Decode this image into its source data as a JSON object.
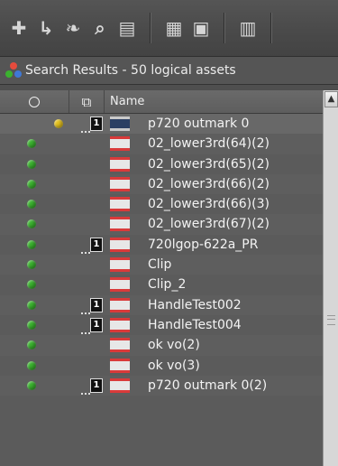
{
  "toolbar": {
    "buttons": [
      {
        "name": "add-icon",
        "glyph": "+"
      },
      {
        "name": "move-icon",
        "glyph": "↳"
      },
      {
        "name": "tree-icon",
        "glyph": "♣"
      },
      {
        "name": "find-icon",
        "glyph": "⌕"
      },
      {
        "name": "list-icon",
        "glyph": "▤"
      },
      {
        "name": "export-icon",
        "glyph": "▦"
      },
      {
        "name": "folder-icon",
        "glyph": "▣"
      },
      {
        "name": "columns-icon",
        "glyph": "▥"
      }
    ]
  },
  "results": {
    "label": "Search Results - 50 logical assets"
  },
  "grid": {
    "columns": [
      "Name"
    ],
    "rows": [
      {
        "name": "p720 outmark 0",
        "status": "yellow",
        "versioned": true,
        "media": "gxf",
        "version_badge": "1"
      },
      {
        "name": "02_lower3rd(64)(2)",
        "status": "green",
        "versioned": false,
        "media": "clip"
      },
      {
        "name": "02_lower3rd(65)(2)",
        "status": "green",
        "versioned": false,
        "media": "clip"
      },
      {
        "name": "02_lower3rd(66)(2)",
        "status": "green",
        "versioned": false,
        "media": "clip"
      },
      {
        "name": "02_lower3rd(66)(3)",
        "status": "green",
        "versioned": false,
        "media": "clip"
      },
      {
        "name": "02_lower3rd(67)(2)",
        "status": "green",
        "versioned": false,
        "media": "clip"
      },
      {
        "name": "720lgop-622a_PR",
        "status": "green",
        "versioned": true,
        "media": "clip",
        "version_badge": "1"
      },
      {
        "name": "Clip",
        "status": "green",
        "versioned": false,
        "media": "clip"
      },
      {
        "name": "Clip_2",
        "status": "green",
        "versioned": false,
        "media": "clip"
      },
      {
        "name": "HandleTest002",
        "status": "green",
        "versioned": true,
        "media": "clip",
        "version_badge": "1"
      },
      {
        "name": "HandleTest004",
        "status": "green",
        "versioned": true,
        "media": "clip",
        "version_badge": "1"
      },
      {
        "name": "ok vo(2)",
        "status": "green",
        "versioned": false,
        "media": "clip"
      },
      {
        "name": "ok vo(3)",
        "status": "green",
        "versioned": false,
        "media": "clip"
      },
      {
        "name": "p720 outmark 0(2)",
        "status": "green",
        "versioned": true,
        "media": "clip",
        "version_badge": "1"
      }
    ]
  },
  "colors": {
    "status_green": "#3bb22f",
    "status_yellow": "#e5c21e",
    "clip_red": "#d93a3a"
  }
}
